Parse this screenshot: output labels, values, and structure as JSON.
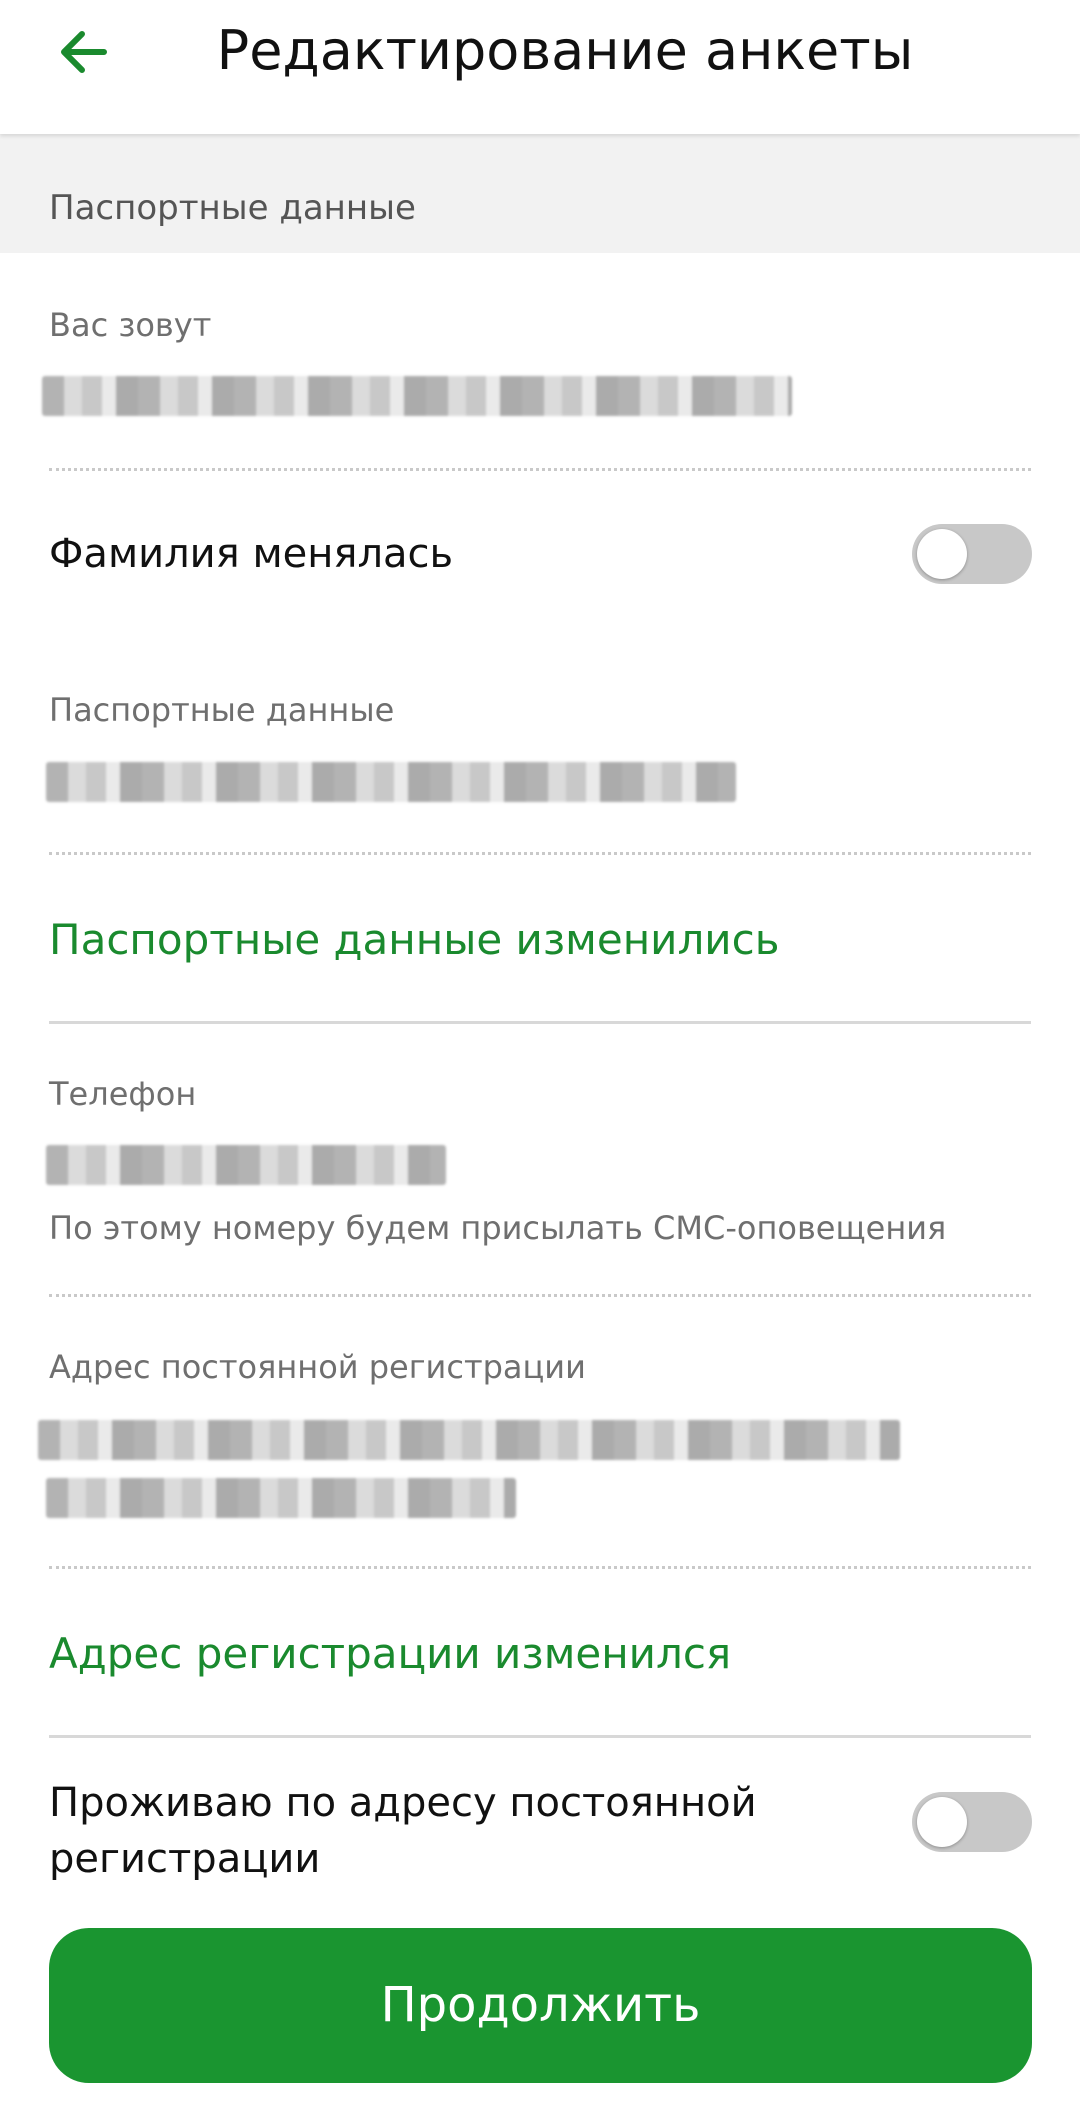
{
  "header": {
    "title": "Редактирование анкеты",
    "back_icon": "arrow-left-icon"
  },
  "section": {
    "title": "Паспортные данные"
  },
  "fields": {
    "name_label": "Вас зовут",
    "surname_changed_label": "Фамилия менялась",
    "passport_label": "Паспортные данные",
    "passport_changed_link": "Паспортные данные изменились",
    "phone_label": "Телефон",
    "phone_hint": "По этому номеру будем присылать СМС-оповещения",
    "address_label": "Адрес постоянной регистрации",
    "address_changed_link": "Адрес регистрации изменился",
    "live_at_address_label": "Проживаю по адресу постоянной регистрации"
  },
  "toggles": {
    "surname_changed": false,
    "live_at_address": false
  },
  "actions": {
    "continue_label": "Продолжить"
  },
  "colors": {
    "accent": "#1a8a2e",
    "button": "#1a9530",
    "toggle_off": "#c8c8c8"
  }
}
